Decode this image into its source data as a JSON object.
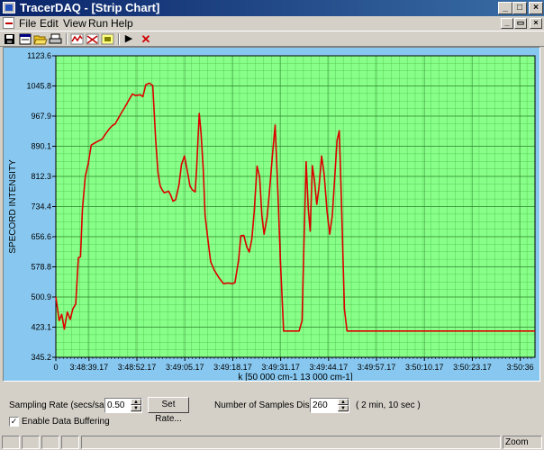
{
  "window": {
    "title": "TracerDAQ - [Strip Chart]"
  },
  "menu": {
    "items": [
      "File",
      "Edit",
      "View",
      "Run",
      "Help"
    ]
  },
  "toolbar": {
    "buttons": [
      "save-icon",
      "window-icon",
      "open-folder-icon",
      "print-icon",
      "channel-config-icon",
      "trigger-config-icon",
      "display-config-icon",
      "run-icon",
      "stop-icon"
    ],
    "play_glyph": "▶",
    "stop_glyph": "✕"
  },
  "chart_data": {
    "type": "line",
    "xlabel": "k [50 000 cm-1  13 000 cm-1]",
    "ylabel": "SPECORD INTENSITY",
    "y_ticks": [
      "1123.6",
      "1045.8",
      "967.9",
      "890.1",
      "812.3",
      "734.4",
      "656.6",
      "578.8",
      "500.9",
      "423.1",
      "345.2"
    ],
    "ylim": [
      345.2,
      1123.6
    ],
    "x_ticks": [
      "3:48:39.17",
      "3:48:52.17",
      "3:49:05.17",
      "3:49:18.17",
      "3:49:31.17",
      "3:49:44.17",
      "3:49:57.17",
      "3:50:10.17",
      "3:50:23.17",
      "3:50:36"
    ],
    "x_tick_values": [
      9,
      22,
      35,
      48,
      61,
      74,
      87,
      100,
      113,
      126
    ],
    "x_start_label_value": 0,
    "xlim": [
      0,
      130
    ],
    "grid": true,
    "colors": {
      "background": "#88ff88",
      "grid": "#44bb44",
      "line": "#dd0000",
      "frame": "#88c8f0"
    },
    "series": [
      {
        "values": [
          [
            0.0,
            501
          ],
          [
            0.9,
            440
          ],
          [
            1.6,
            456
          ],
          [
            2.3,
            418
          ],
          [
            3.1,
            462
          ],
          [
            3.9,
            443
          ],
          [
            4.6,
            470
          ],
          [
            5.4,
            483
          ],
          [
            6.1,
            602
          ],
          [
            6.7,
            605
          ],
          [
            7.2,
            727
          ],
          [
            8.0,
            812
          ],
          [
            8.8,
            846
          ],
          [
            9.6,
            893
          ],
          [
            10.3,
            897
          ],
          [
            11.0,
            901
          ],
          [
            12.5,
            908
          ],
          [
            13.5,
            922
          ],
          [
            14.5,
            935
          ],
          [
            15.3,
            943
          ],
          [
            16.1,
            948
          ],
          [
            17.4,
            970
          ],
          [
            18.8,
            992
          ],
          [
            20.2,
            1016
          ],
          [
            20.8,
            1025
          ],
          [
            21.6,
            1021
          ],
          [
            22.9,
            1023
          ],
          [
            23.6,
            1018
          ],
          [
            24.4,
            1049
          ],
          [
            25.4,
            1053
          ],
          [
            26.3,
            1047
          ],
          [
            27.1,
            905
          ],
          [
            27.7,
            822
          ],
          [
            28.3,
            788
          ],
          [
            28.8,
            778
          ],
          [
            29.4,
            770
          ],
          [
            30.6,
            774
          ],
          [
            31.1,
            765
          ],
          [
            31.8,
            748
          ],
          [
            32.5,
            752
          ],
          [
            33.4,
            790
          ],
          [
            34.1,
            843
          ],
          [
            34.9,
            865
          ],
          [
            35.7,
            825
          ],
          [
            36.4,
            787
          ],
          [
            37.0,
            778
          ],
          [
            37.8,
            772
          ],
          [
            38.2,
            832
          ],
          [
            38.9,
            975
          ],
          [
            39.4,
            925
          ],
          [
            40.0,
            830
          ],
          [
            40.5,
            712
          ],
          [
            41.3,
            646
          ],
          [
            42.0,
            592
          ],
          [
            43.0,
            570
          ],
          [
            44.3,
            550
          ],
          [
            45.5,
            535
          ],
          [
            46.8,
            537
          ],
          [
            47.9,
            535
          ],
          [
            48.6,
            538
          ],
          [
            49.6,
            598
          ],
          [
            50.2,
            659
          ],
          [
            51.0,
            660
          ],
          [
            51.8,
            630
          ],
          [
            52.5,
            617
          ],
          [
            53.2,
            652
          ],
          [
            53.8,
            720
          ],
          [
            54.6,
            839
          ],
          [
            55.3,
            810
          ],
          [
            55.9,
            710
          ],
          [
            56.5,
            663
          ],
          [
            57.3,
            706
          ],
          [
            57.9,
            765
          ],
          [
            58.8,
            870
          ],
          [
            59.5,
            945
          ],
          [
            60.2,
            780
          ],
          [
            61.0,
            580
          ],
          [
            61.8,
            413
          ],
          [
            66.0,
            413
          ],
          [
            66.8,
            440
          ],
          [
            67.3,
            633
          ],
          [
            67.9,
            850
          ],
          [
            68.5,
            728
          ],
          [
            69.0,
            671
          ],
          [
            69.6,
            840
          ],
          [
            70.2,
            798
          ],
          [
            70.8,
            740
          ],
          [
            71.4,
            785
          ],
          [
            72.1,
            865
          ],
          [
            72.8,
            818
          ],
          [
            73.6,
            720
          ],
          [
            74.3,
            663
          ],
          [
            75.0,
            710
          ],
          [
            75.6,
            800
          ],
          [
            76.3,
            905
          ],
          [
            76.9,
            930
          ],
          [
            77.5,
            740
          ],
          [
            78.3,
            470
          ],
          [
            79.0,
            413
          ],
          [
            130.0,
            413
          ]
        ]
      }
    ]
  },
  "controls": {
    "sampling_rate_label": "Sampling Rate (secs/sample)",
    "sampling_rate_value": "0.50",
    "set_rate_button": "Set Rate...",
    "samples_label": "Number of Samples Displayed",
    "samples_value": "260",
    "samples_duration": "( 2 min, 10 sec )",
    "buffering_label": "Enable Data Buffering",
    "buffering_checked": "✓"
  },
  "status": {
    "zoom": "Zoom Off"
  }
}
